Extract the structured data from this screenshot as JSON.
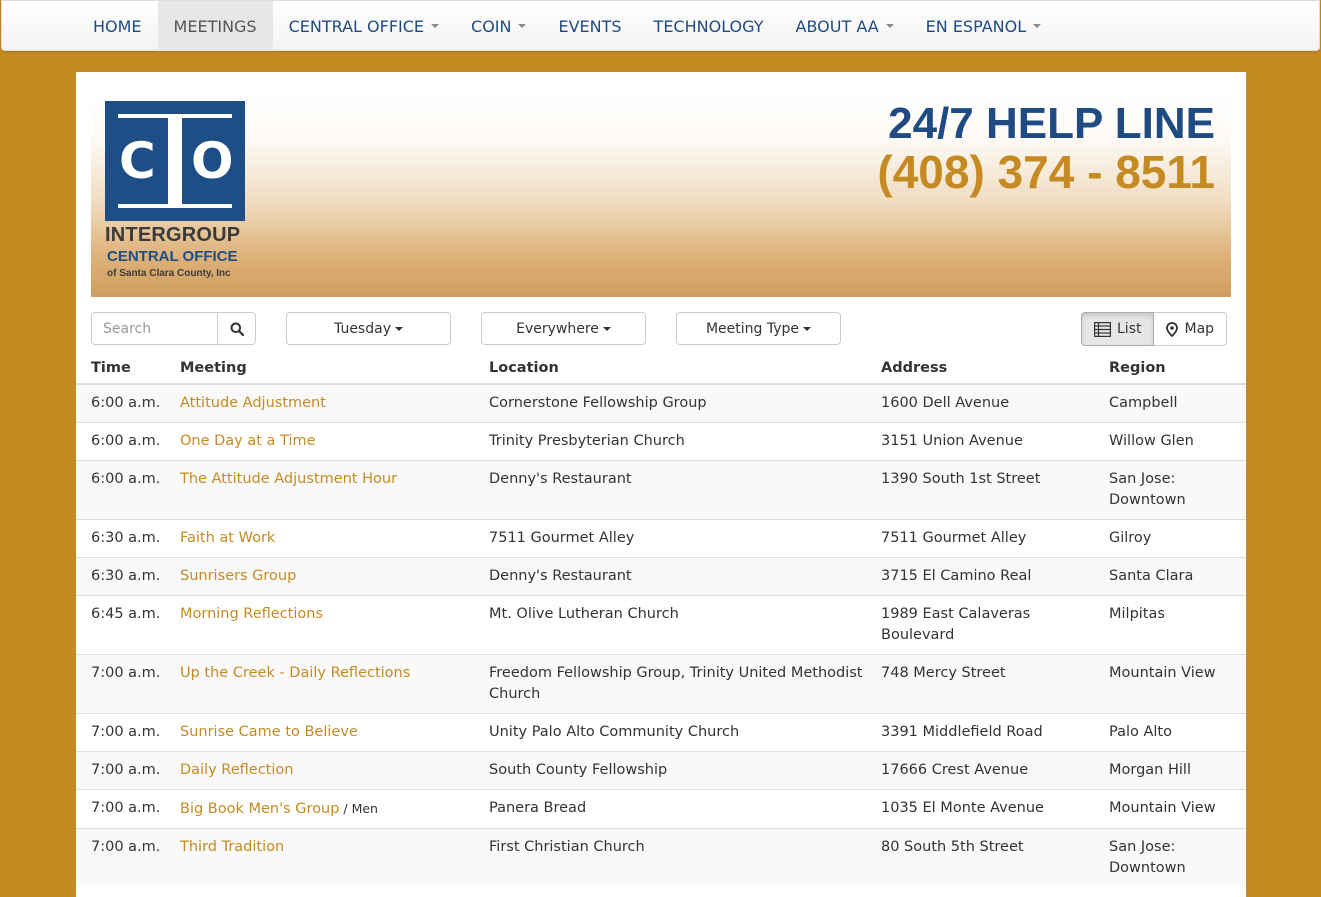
{
  "nav": {
    "items": [
      {
        "label": "HOME",
        "dropdown": false,
        "active": false
      },
      {
        "label": "MEETINGS",
        "dropdown": false,
        "active": true
      },
      {
        "label": "CENTRAL OFFICE",
        "dropdown": true,
        "active": false
      },
      {
        "label": "COIN",
        "dropdown": true,
        "active": false
      },
      {
        "label": "EVENTS",
        "dropdown": false,
        "active": false
      },
      {
        "label": "TECHNOLOGY",
        "dropdown": false,
        "active": false
      },
      {
        "label": "ABOUT AA",
        "dropdown": true,
        "active": false
      },
      {
        "label": "EN ESPANOL",
        "dropdown": true,
        "active": false
      }
    ]
  },
  "header": {
    "logo": {
      "letter_left": "C",
      "letter_right": "O",
      "name_line1": "INTERGROUP",
      "name_line2": "CENTRAL OFFICE",
      "name_line3": "of Santa Clara County, Inc"
    },
    "helpline_title": "24/7 HELP LINE",
    "helpline_phone": "(408) 374 - 8511"
  },
  "filters": {
    "search_placeholder": "Search",
    "day": "Tuesday",
    "distance": "Everywhere",
    "type": "Meeting Type",
    "view_list": "List",
    "view_map": "Map"
  },
  "table": {
    "headers": {
      "time": "Time",
      "meeting": "Meeting",
      "location": "Location",
      "address": "Address",
      "region": "Region"
    },
    "rows": [
      {
        "time": "6:00 a.m.",
        "meeting": "Attitude Adjustment",
        "type": "",
        "location": "Cornerstone Fellowship Group",
        "address": "1600 Dell Avenue",
        "region": "Campbell"
      },
      {
        "time": "6:00 a.m.",
        "meeting": "One Day at a Time",
        "type": "",
        "location": "Trinity Presbyterian Church",
        "address": "3151 Union Avenue",
        "region": "Willow Glen"
      },
      {
        "time": "6:00 a.m.",
        "meeting": "The Attitude Adjustment Hour",
        "type": "",
        "location": "Denny's Restaurant",
        "address": "1390 South 1st Street",
        "region": "San Jose: Downtown"
      },
      {
        "time": "6:30 a.m.",
        "meeting": "Faith at Work",
        "type": "",
        "location": "7511 Gourmet Alley",
        "address": "7511 Gourmet Alley",
        "region": "Gilroy"
      },
      {
        "time": "6:30 a.m.",
        "meeting": "Sunrisers Group",
        "type": "",
        "location": "Denny's Restaurant",
        "address": "3715 El Camino Real",
        "region": "Santa Clara"
      },
      {
        "time": "6:45 a.m.",
        "meeting": "Morning Reflections",
        "type": "",
        "location": "Mt. Olive Lutheran Church",
        "address": "1989 East Calaveras Boulevard",
        "region": "Milpitas"
      },
      {
        "time": "7:00 a.m.",
        "meeting": "Up the Creek - Daily Reflections",
        "type": "",
        "location": "Freedom Fellowship Group, Trinity United Methodist Church",
        "address": "748 Mercy Street",
        "region": "Mountain View"
      },
      {
        "time": "7:00 a.m.",
        "meeting": "Sunrise Came to Believe",
        "type": "",
        "location": "Unity Palo Alto Community Church",
        "address": "3391 Middlefield Road",
        "region": "Palo Alto"
      },
      {
        "time": "7:00 a.m.",
        "meeting": "Daily Reflection",
        "type": "",
        "location": "South County Fellowship",
        "address": "17666 Crest Avenue",
        "region": "Morgan Hill"
      },
      {
        "time": "7:00 a.m.",
        "meeting": "Big Book Men's Group",
        "type": " / Men",
        "location": "Panera Bread",
        "address": "1035 El Monte Avenue",
        "region": "Mountain View"
      },
      {
        "time": "7:00 a.m.",
        "meeting": "Third Tradition",
        "type": "",
        "location": "First Christian Church",
        "address": "80 South 5th Street",
        "region": "San Jose: Downtown"
      }
    ]
  },
  "colors": {
    "accent": "#c68a22",
    "brand_blue": "#1f4a82",
    "page_bg": "#c68a22"
  }
}
